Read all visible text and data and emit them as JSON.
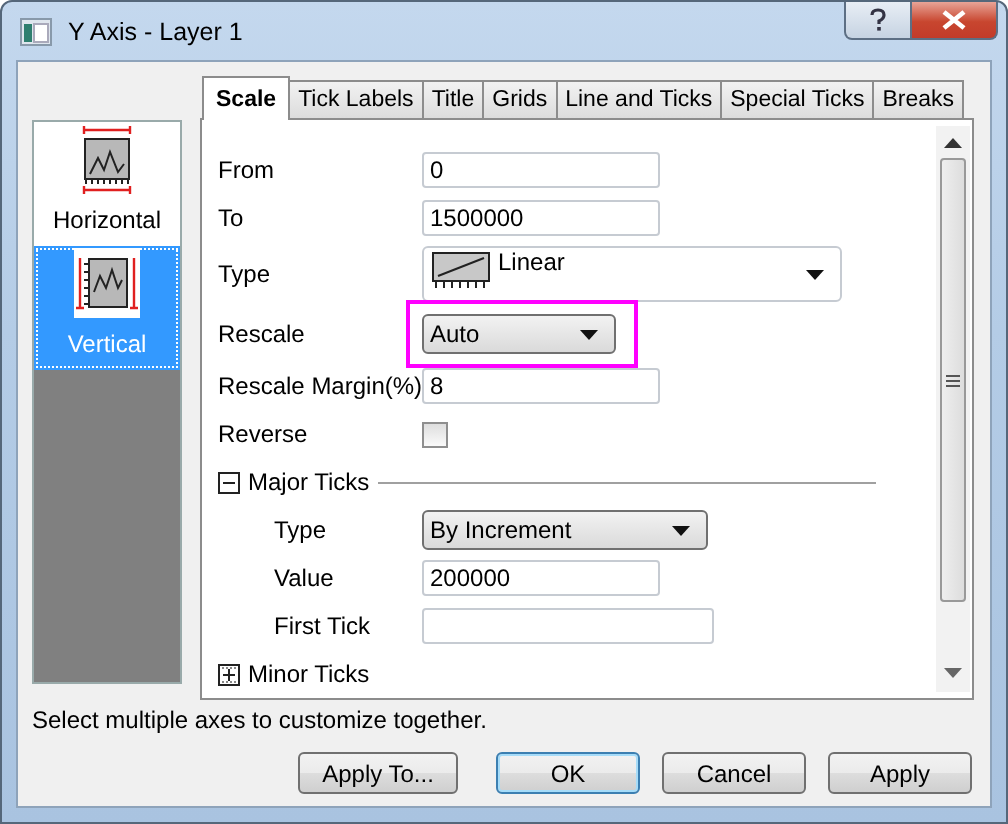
{
  "window": {
    "title": "Y Axis - Layer 1"
  },
  "axes": [
    {
      "label": "Horizontal",
      "kind": "horizontal",
      "selected": false
    },
    {
      "label": "Vertical",
      "kind": "vertical",
      "selected": true
    }
  ],
  "tabs": [
    {
      "label": "Scale",
      "selected": true
    },
    {
      "label": "Tick Labels",
      "selected": false
    },
    {
      "label": "Title",
      "selected": false
    },
    {
      "label": "Grids",
      "selected": false
    },
    {
      "label": "Line and Ticks",
      "selected": false
    },
    {
      "label": "Special Ticks",
      "selected": false
    },
    {
      "label": "Breaks",
      "selected": false
    }
  ],
  "rows": [
    {
      "kind": "text",
      "label": "From",
      "value": "0"
    },
    {
      "kind": "text",
      "label": "To",
      "value": "1500000"
    },
    {
      "kind": "scale-combo",
      "label": "Type",
      "value": "Linear"
    },
    {
      "kind": "combo",
      "label": "Rescale",
      "value": "Auto",
      "highlighted": true
    },
    {
      "kind": "text",
      "label": "Rescale Margin(%)",
      "value": "8"
    },
    {
      "kind": "checkbox",
      "label": "Reverse",
      "checked": false
    },
    {
      "kind": "group",
      "label": "Major Ticks",
      "expanded": true,
      "children": [
        {
          "kind": "combo",
          "label": "Type",
          "value": "By Increment"
        },
        {
          "kind": "text",
          "label": "Value",
          "value": "200000"
        },
        {
          "kind": "text",
          "label": "First Tick"
        }
      ]
    },
    {
      "kind": "group",
      "label": "Minor Ticks",
      "expanded": false
    }
  ],
  "hint": "Select multiple axes to customize together.",
  "buttons": [
    {
      "label": "Apply To...",
      "default": false
    },
    {
      "label": "OK",
      "default": true
    },
    {
      "label": "Cancel",
      "default": false
    },
    {
      "label": "Apply",
      "default": false
    }
  ]
}
